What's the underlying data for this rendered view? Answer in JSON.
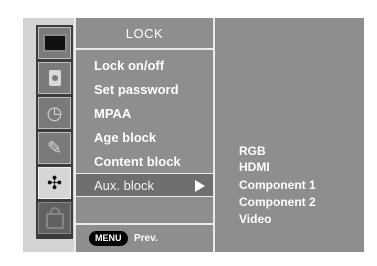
{
  "menu": {
    "title": "LOCK",
    "items": [
      {
        "label": "Lock on/off"
      },
      {
        "label": "Set password"
      },
      {
        "label": "MPAA"
      },
      {
        "label": "Age block"
      },
      {
        "label": "Content block"
      },
      {
        "label": "Aux. block",
        "selected": true
      }
    ],
    "footer": {
      "button": "MENU",
      "label": "Prev."
    }
  },
  "submenu": {
    "items": [
      "RGB",
      "HDMI",
      "Component 1",
      "Component 2",
      "Video"
    ]
  },
  "sidebar": {
    "icons": [
      {
        "name": "picture",
        "icon": "tv-screen-icon"
      },
      {
        "name": "audio",
        "icon": "speaker-icon"
      },
      {
        "name": "time",
        "icon": "clock-icon"
      },
      {
        "name": "option",
        "icon": "wrench-icon"
      },
      {
        "name": "setup",
        "icon": "sliders-icon",
        "active": true
      },
      {
        "name": "lock",
        "icon": "lock-icon"
      }
    ]
  },
  "colors": {
    "frame": "#d3d3d3",
    "panel": "#8e8e8e",
    "rail": "#3c3c3c",
    "selected_row": "#6f6f6f"
  }
}
